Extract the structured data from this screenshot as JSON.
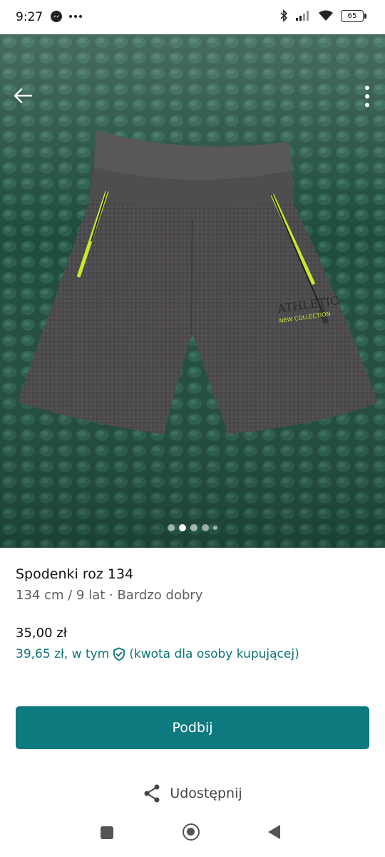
{
  "status_bar": {
    "time": "9:27",
    "battery": "65",
    "icons": [
      "messenger-icon",
      "more-icon",
      "bluetooth-icon",
      "signal-icon",
      "wifi-icon",
      "battery-icon"
    ]
  },
  "gallery": {
    "page_count": 5,
    "active_index": 1
  },
  "listing": {
    "title": "Spodenki roz 134",
    "subtitle": "134 cm / 9 lat · Bardzo dobry",
    "price": "35,00 zł",
    "buyer_price_prefix": "39,65 zł, w tym",
    "buyer_price_suffix": "(kwota dla osoby kupującej)"
  },
  "actions": {
    "bump_label": "Podbij",
    "share_label": "Udostępnij"
  },
  "colors": {
    "accent": "#0d7a80",
    "link": "#0e7478"
  }
}
